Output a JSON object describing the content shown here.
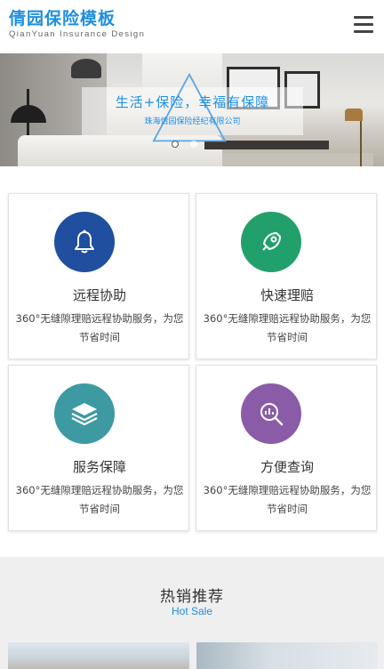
{
  "header": {
    "logo_title": "倩园保险模板",
    "logo_subtitle": "QianYuan Insurance Design",
    "menu_icon": "hamburger-menu-icon"
  },
  "banner": {
    "title": "生活+保险，幸福有保障",
    "subtitle": "珠海倩园保险经纪有限公司",
    "slide_count": 2,
    "active_slide": 1
  },
  "services": [
    {
      "title": "远程协助",
      "desc": "360°无缝隙理赔远程协助服务，为您节省时间",
      "icon": "bell-icon",
      "color": "#1f4f9e"
    },
    {
      "title": "快速理赔",
      "desc": "360°无缝隙理赔远程协助服务，为您节省时间",
      "icon": "rocket-icon",
      "color": "#22a06b"
    },
    {
      "title": "服务保障",
      "desc": "360°无缝隙理赔远程协助服务，为您节省时间",
      "icon": "layers-icon",
      "color": "#3d9aa3"
    },
    {
      "title": "方便查询",
      "desc": "360°无缝隙理赔远程协助服务，为您节省时间",
      "icon": "search-chart-icon",
      "color": "#8a5ca8"
    }
  ],
  "hot_sale": {
    "title": "热销推荐",
    "subtitle": "Hot Sale"
  },
  "colors": {
    "brand_blue": "#1e8fe0",
    "section_bg": "#efefef"
  }
}
